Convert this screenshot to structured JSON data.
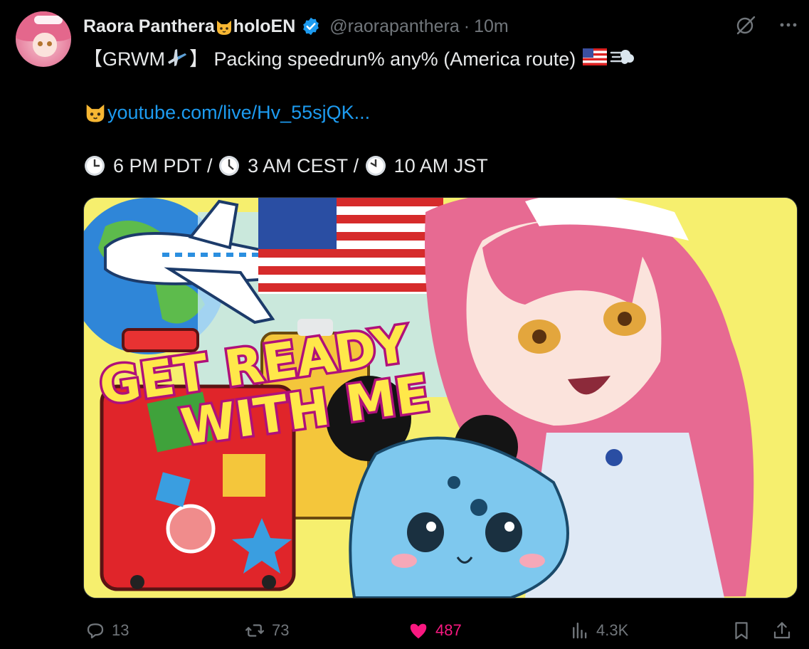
{
  "author": {
    "name": "Raora Panthera",
    "name_suffix": "holoEN",
    "handle": "@raorapanthera",
    "separator": "·",
    "time": "10m",
    "verified_icon": "verified-badge-icon",
    "emoji": "cat-face-emoji"
  },
  "tweet": {
    "line1_prefix": "【GRWM",
    "line1_suffix": "】 Packing speedrun% any% (America route)",
    "link": "youtube.com/live/Hv_55sjQK...",
    "times": [
      "6 PM PDT",
      "3 AM CEST",
      "10 AM JST"
    ],
    "time_sep": "/"
  },
  "media": {
    "banner_line1": "GET READY",
    "banner_line2": "WITH ME"
  },
  "actions": {
    "replies": "13",
    "reposts": "73",
    "likes": "487",
    "views": "4.3K"
  },
  "colors": {
    "accent": "#1d9bf0",
    "like": "#f91880",
    "muted": "#71767b",
    "text": "#e7e9ea"
  }
}
